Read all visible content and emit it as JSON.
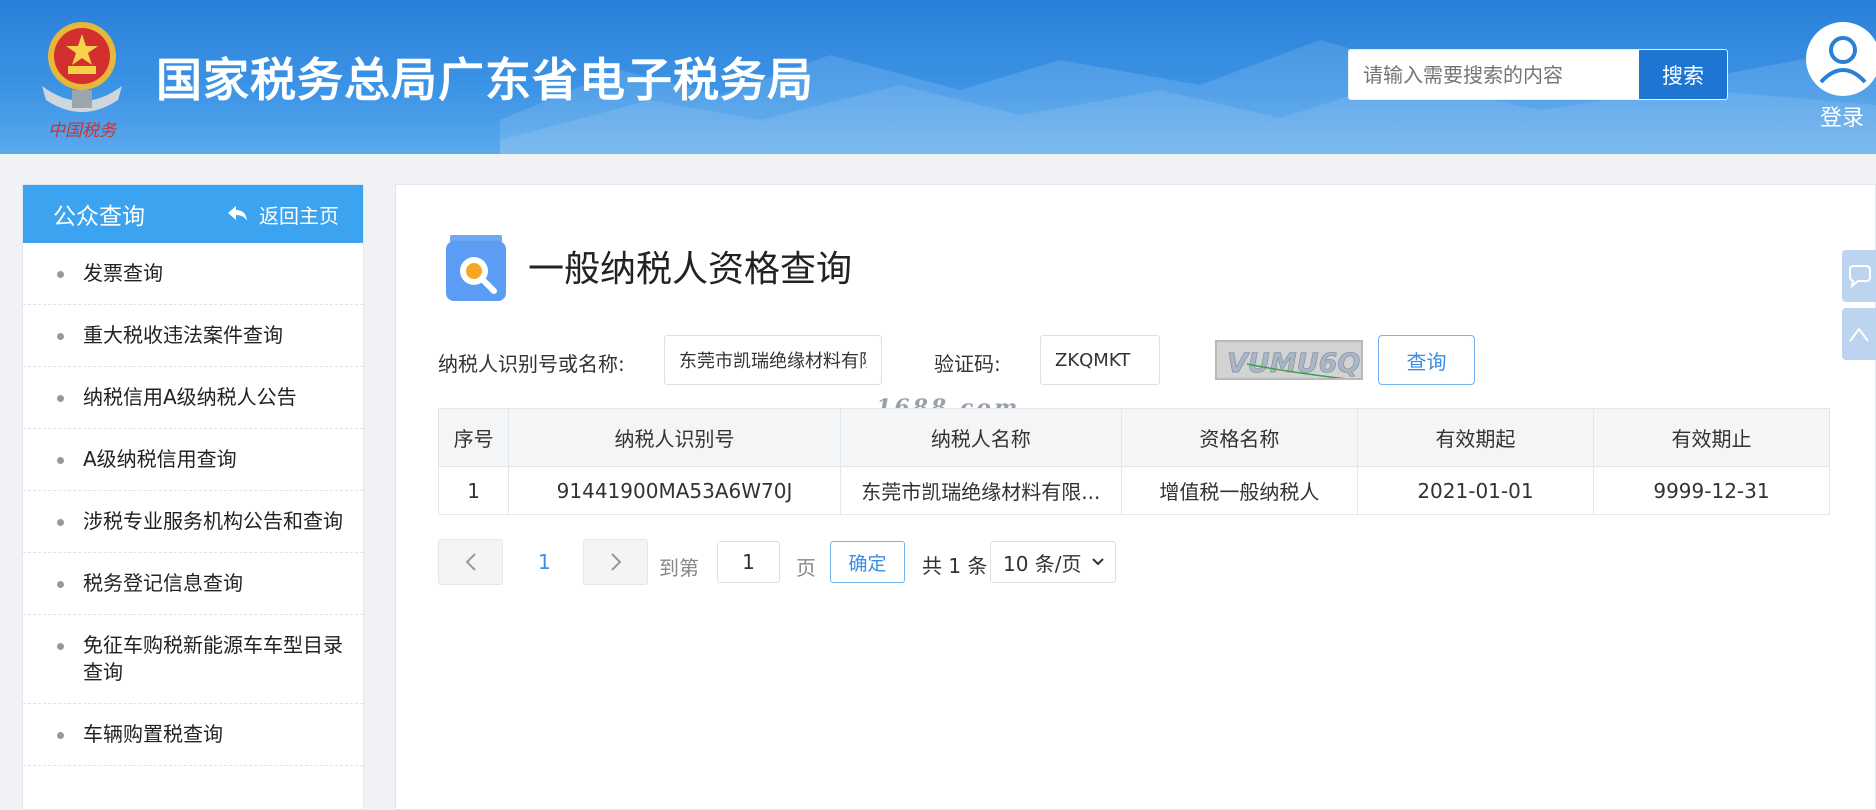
{
  "header": {
    "site_title": "国家税务总局广东省电子税务局",
    "search_placeholder": "请输入需要搜索的内容",
    "search_button": "搜索",
    "login_label": "登录",
    "brand_color": "#2a7fd8"
  },
  "sidebar": {
    "title": "公众查询",
    "back_label": "返回主页",
    "items": [
      {
        "label": "发票查询"
      },
      {
        "label": "重大税收违法案件查询"
      },
      {
        "label": "纳税信用A级纳税人公告"
      },
      {
        "label": "A级纳税信用查询"
      },
      {
        "label": "涉税专业服务机构公告和查询"
      },
      {
        "label": "税务登记信息查询"
      },
      {
        "label": "免征车购税新能源车车型目录查询"
      },
      {
        "label": "车辆购置税查询"
      }
    ]
  },
  "main": {
    "page_title": "一般纳税人资格查询",
    "form": {
      "taxpayer_label": "纳税人识别号或名称:",
      "taxpayer_value": "东莞市凯瑞绝缘材料有限公司",
      "captcha_label": "验证码:",
      "captcha_value": "ZKQMKT",
      "captcha_image_text": "VUMU6Q",
      "query_button": "查询"
    },
    "watermark": "1688.com",
    "table": {
      "headers": [
        "序号",
        "纳税人识别号",
        "纳税人名称",
        "资格名称",
        "有效期起",
        "有效期止"
      ],
      "rows": [
        [
          "1",
          "91441900MA53A6W70J",
          "东莞市凯瑞绝缘材料有限...",
          "增值税一般纳税人",
          "2021-01-01",
          "9999-12-31"
        ]
      ]
    },
    "pagination": {
      "current_page": "1",
      "goto_label": "到第",
      "page_input_value": "1",
      "page_unit": "页",
      "confirm_button": "确定",
      "total_text": "共 1 条",
      "page_size": "10 条/页"
    }
  },
  "floating_tabs": [
    {
      "icon": "chat-bubble-icon"
    },
    {
      "icon": "back-to-top-icon"
    }
  ]
}
